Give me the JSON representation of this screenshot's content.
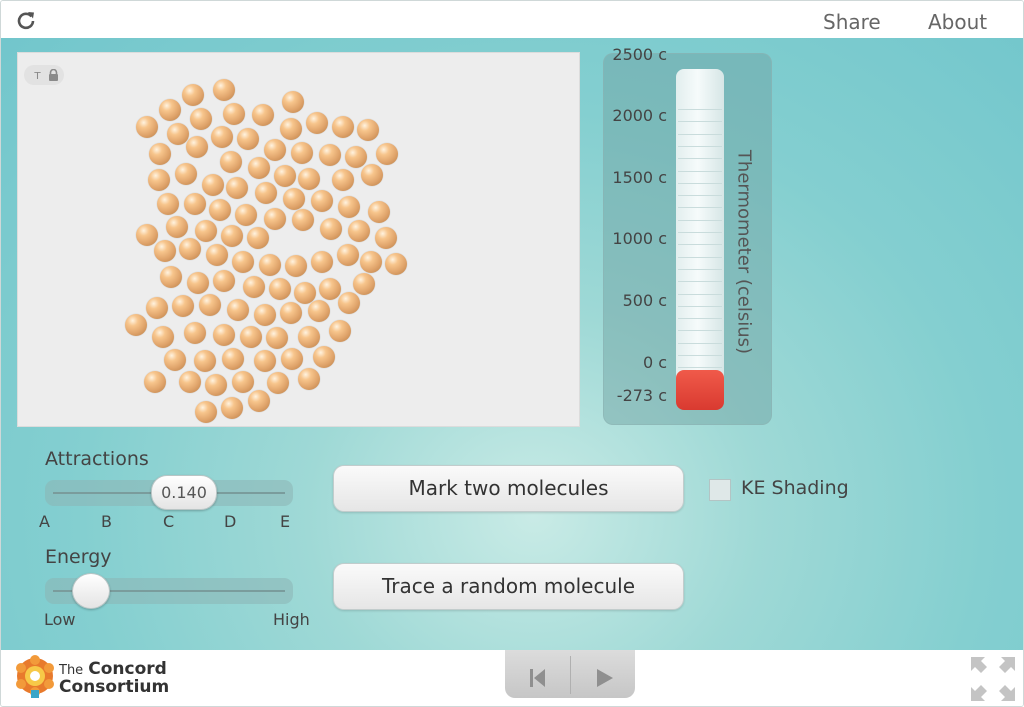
{
  "topbar": {
    "reload_icon": "reload-icon",
    "share_label": "Share",
    "about_label": "About"
  },
  "simulation": {
    "icons": [
      "thermometer-icon",
      "lock-icon"
    ],
    "atom_color": "#e0a46b"
  },
  "thermometer": {
    "title": "Thermometer (celsius)",
    "scale_labels": [
      "2500 c",
      "2000 c",
      "1500 c",
      "1000 c",
      "500 c",
      "0 c",
      "-273 c"
    ],
    "fill_color": "#e34a3d"
  },
  "attractions": {
    "label": "Attractions",
    "value": "0.140",
    "ticks": [
      "A",
      "B",
      "C",
      "D",
      "E"
    ]
  },
  "energy": {
    "label": "Energy",
    "low_label": "Low",
    "high_label": "High",
    "level": 0.13
  },
  "buttons": {
    "mark_two": "Mark two molecules",
    "trace_random": "Trace a random molecule"
  },
  "ke_shading": {
    "label": "KE Shading",
    "checked": false
  },
  "footer": {
    "logo_line1": "The",
    "logo_line1b": "Concord",
    "logo_line2": "Consortium",
    "playback_icons": [
      "step-back-icon",
      "play-icon"
    ],
    "fullscreen_icon": "fullscreen-icon"
  }
}
